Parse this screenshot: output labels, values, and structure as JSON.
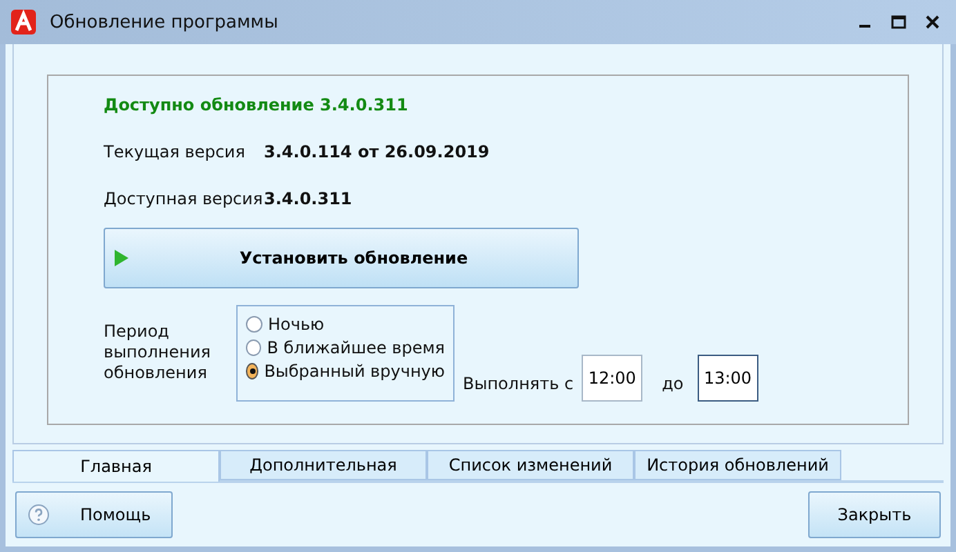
{
  "window": {
    "title": "Обновление программы"
  },
  "update_available": "Доступно обновление 3.4.0.311",
  "info": [
    {
      "label": "Текущая версия",
      "value": "3.4.0.114 от 26.09.2019"
    },
    {
      "label": "Доступная версия",
      "value": "3.4.0.311"
    }
  ],
  "install_button": "Установить обновление",
  "period": {
    "label": "Период выполнения обновления",
    "options": [
      {
        "label": "Ночью",
        "selected": false
      },
      {
        "label": "В ближайшее время",
        "selected": false
      },
      {
        "label": "Выбранный вручную",
        "selected": true
      }
    ],
    "from_label": "Выполнять с",
    "from": "12:00",
    "to_label": "до",
    "to": "13:00"
  },
  "tabs": [
    {
      "label": "Главная",
      "selected": true
    },
    {
      "label": "Дополнительная",
      "selected": false
    },
    {
      "label": "Список изменений",
      "selected": false
    },
    {
      "label": "История обновлений",
      "selected": false
    }
  ],
  "buttons": {
    "help": "Помощь",
    "close": "Закрыть"
  }
}
